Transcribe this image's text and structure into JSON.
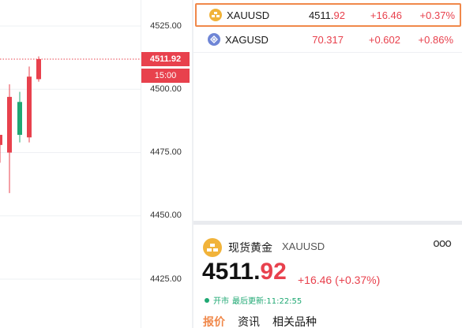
{
  "chart": {
    "y_ticks": [
      "4525.00",
      "4500.00",
      "4475.00",
      "4450.00",
      "4425.00"
    ],
    "current_price_tag": "4511.92",
    "time_tag": "15:00",
    "up_color": "#e8414d",
    "down_color": "#1fa873"
  },
  "chart_data": {
    "type": "candlestick",
    "y_ticks": [
      4525,
      4500,
      4475,
      4450,
      4425
    ],
    "ylim": [
      4420,
      4535
    ],
    "reference_line": 4511.92,
    "candles": [
      {
        "open": 4478,
        "close": 4482,
        "high": 4480,
        "low": 4471,
        "color": "up"
      },
      {
        "open": 4475,
        "close": 4497,
        "high": 4502,
        "low": 4459,
        "color": "up"
      },
      {
        "open": 4495,
        "close": 4482,
        "high": 4499,
        "low": 4479,
        "color": "down"
      },
      {
        "open": 4481,
        "close": 4505,
        "high": 4509,
        "low": 4479,
        "color": "up"
      },
      {
        "open": 4504,
        "close": 4511.92,
        "high": 4513,
        "low": 4503,
        "color": "up"
      }
    ]
  },
  "watchlist": [
    {
      "symbol": "XAUUSD",
      "price_main": "4511.",
      "price_tail": "92",
      "change": "+16.46",
      "percent": "+0.37%",
      "icon": "gold-bar-icon",
      "icon_color": "#f1b33a",
      "selected": true
    },
    {
      "symbol": "XAGUSD",
      "price_main": "",
      "price_tail": "70.317",
      "change": "+0.602",
      "percent": "+0.86%",
      "icon": "silver-bar-icon",
      "icon_color": "#6f86d6",
      "selected": false
    }
  ],
  "detail": {
    "name": "现货黄金",
    "code": "XAUUSD",
    "more": "ooo",
    "price_main": "4511.",
    "price_tail": "92",
    "change_text": "+16.46 (+0.37%)",
    "status": "开市",
    "update_label": "最后更新:11:22:55",
    "tabs": [
      "报价",
      "资讯",
      "相关品种"
    ],
    "active_tab": 0
  }
}
